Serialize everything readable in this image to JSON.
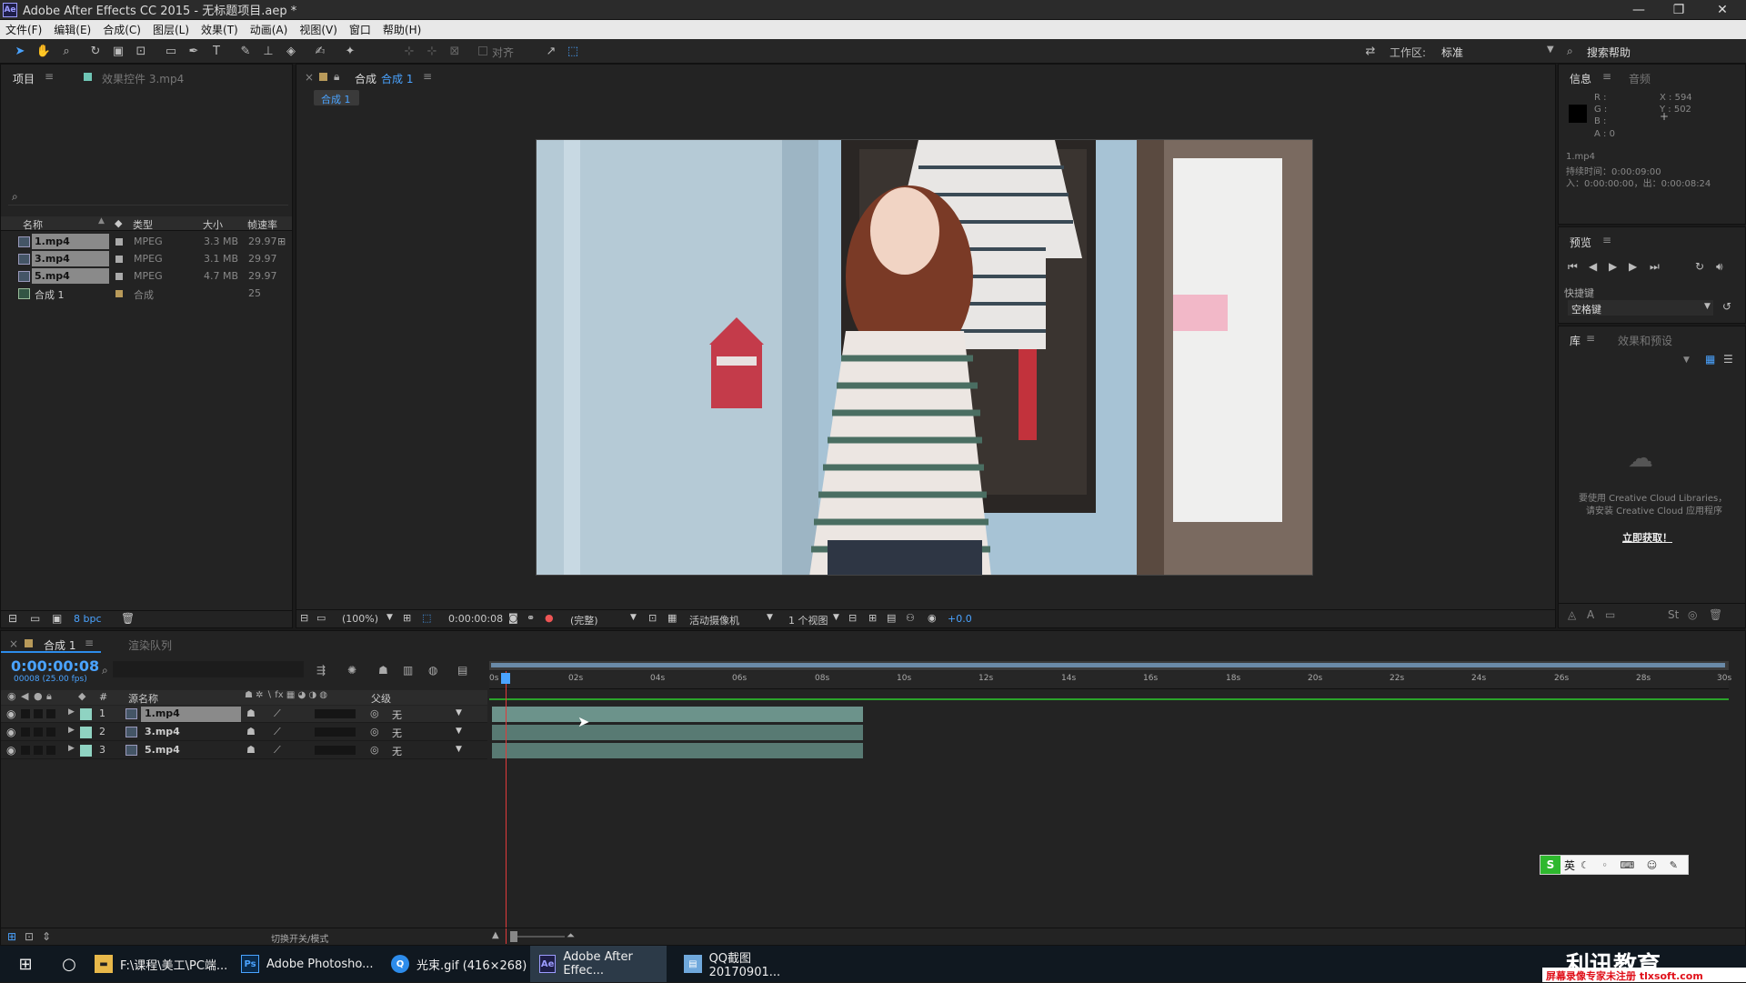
{
  "window": {
    "title": "Adobe After Effects CC 2015 - 无标题项目.aep *",
    "app_badge": "Ae"
  },
  "menu": [
    "文件(F)",
    "编辑(E)",
    "合成(C)",
    "图层(L)",
    "效果(T)",
    "动画(A)",
    "视图(V)",
    "窗口",
    "帮助(H)"
  ],
  "toolbar": {
    "align_label": "对齐",
    "workspace_label": "工作区:",
    "workspace_value": "标准",
    "search_help": "搜索帮助"
  },
  "project_panel": {
    "tab_label": "项目",
    "effects_tab": "效果控件 3.mp4",
    "columns": [
      "名称",
      "类型",
      "大小",
      "帧速率"
    ],
    "items": [
      {
        "name": "1.mp4",
        "type": "MPEG",
        "size": "3.3 MB",
        "fps": "29.97",
        "selected": true
      },
      {
        "name": "3.mp4",
        "type": "MPEG",
        "size": "3.1 MB",
        "fps": "29.97",
        "selected": true
      },
      {
        "name": "5.mp4",
        "type": "MPEG",
        "size": "4.7 MB",
        "fps": "29.97",
        "selected": true
      },
      {
        "name": "合成 1",
        "type": "合成",
        "size": "",
        "fps": "25",
        "selected": false
      }
    ],
    "bpc": "8 bpc"
  },
  "comp_panel": {
    "tab_label": "合成",
    "tab_name": "合成 1",
    "breadcrumb": "合成 1",
    "zoom": "(100%)",
    "timecode": "0:00:00:08",
    "resolution": "(完整)",
    "camera": "活动摄像机",
    "views": "1 个视图",
    "exposure": "+0.0"
  },
  "info_panel": {
    "tab_info": "信息",
    "tab_audio": "音频",
    "r": "R :",
    "g": "G :",
    "b": "B :",
    "a": "A : 0",
    "x": "X : 594",
    "y": "Y : 502",
    "file": "1.mp4",
    "duration": "持续时间：0:00:09:00",
    "in_out": "入：0:00:00:00，出：0:00:08:24"
  },
  "preview_panel": {
    "tab": "预览",
    "shortcut_label": "快捷键",
    "shortcut_value": "空格键"
  },
  "library_panel": {
    "tab": "库",
    "tab2": "效果和预设",
    "msg1": "要使用 Creative Cloud Libraries，",
    "msg2": "请安装 Creative Cloud 应用程序",
    "link": "立即获取！"
  },
  "timeline": {
    "tab_comp": "合成 1",
    "tab_render": "渲染队列",
    "timecode": "0:00:00:08",
    "fps_info": "00008 (25.00 fps)",
    "col_num": "#",
    "col_source": "源名称",
    "col_parent": "父级",
    "ruler": [
      "0s",
      "02s",
      "04s",
      "06s",
      "08s",
      "10s",
      "12s",
      "14s",
      "16s",
      "18s",
      "20s",
      "22s",
      "24s",
      "26s",
      "28s",
      "30s"
    ],
    "layers": [
      {
        "num": "1",
        "name": "1.mp4",
        "parent": "无"
      },
      {
        "num": "2",
        "name": "3.mp4",
        "parent": "无"
      },
      {
        "num": "3",
        "name": "5.mp4",
        "parent": "无"
      }
    ],
    "toggle_label": "切换开关/模式"
  },
  "ime": {
    "lang": "英"
  },
  "taskbar": {
    "items": [
      {
        "label": "F:\\课程\\美工\\PC端...",
        "icon": "folder-icon"
      },
      {
        "label": "Adobe Photosho...",
        "icon": "photoshop-icon"
      },
      {
        "label": "光束.gif (416×268)",
        "icon": "image-viewer-icon"
      },
      {
        "label": "Adobe After Effec...",
        "icon": "after-effects-icon"
      },
      {
        "label": "QQ截图20170901...",
        "icon": "image-icon"
      }
    ],
    "watermark_brand": "利讯教育",
    "watermark_text": "屏幕录像专家未注册 tlxsoft.com"
  },
  "colors": {
    "accent": "#2d8ceb",
    "timecode": "#4aa3ff",
    "clip": "#6c938b",
    "playhead": "#e03a3a",
    "label_teal": "#6fc5b5"
  }
}
